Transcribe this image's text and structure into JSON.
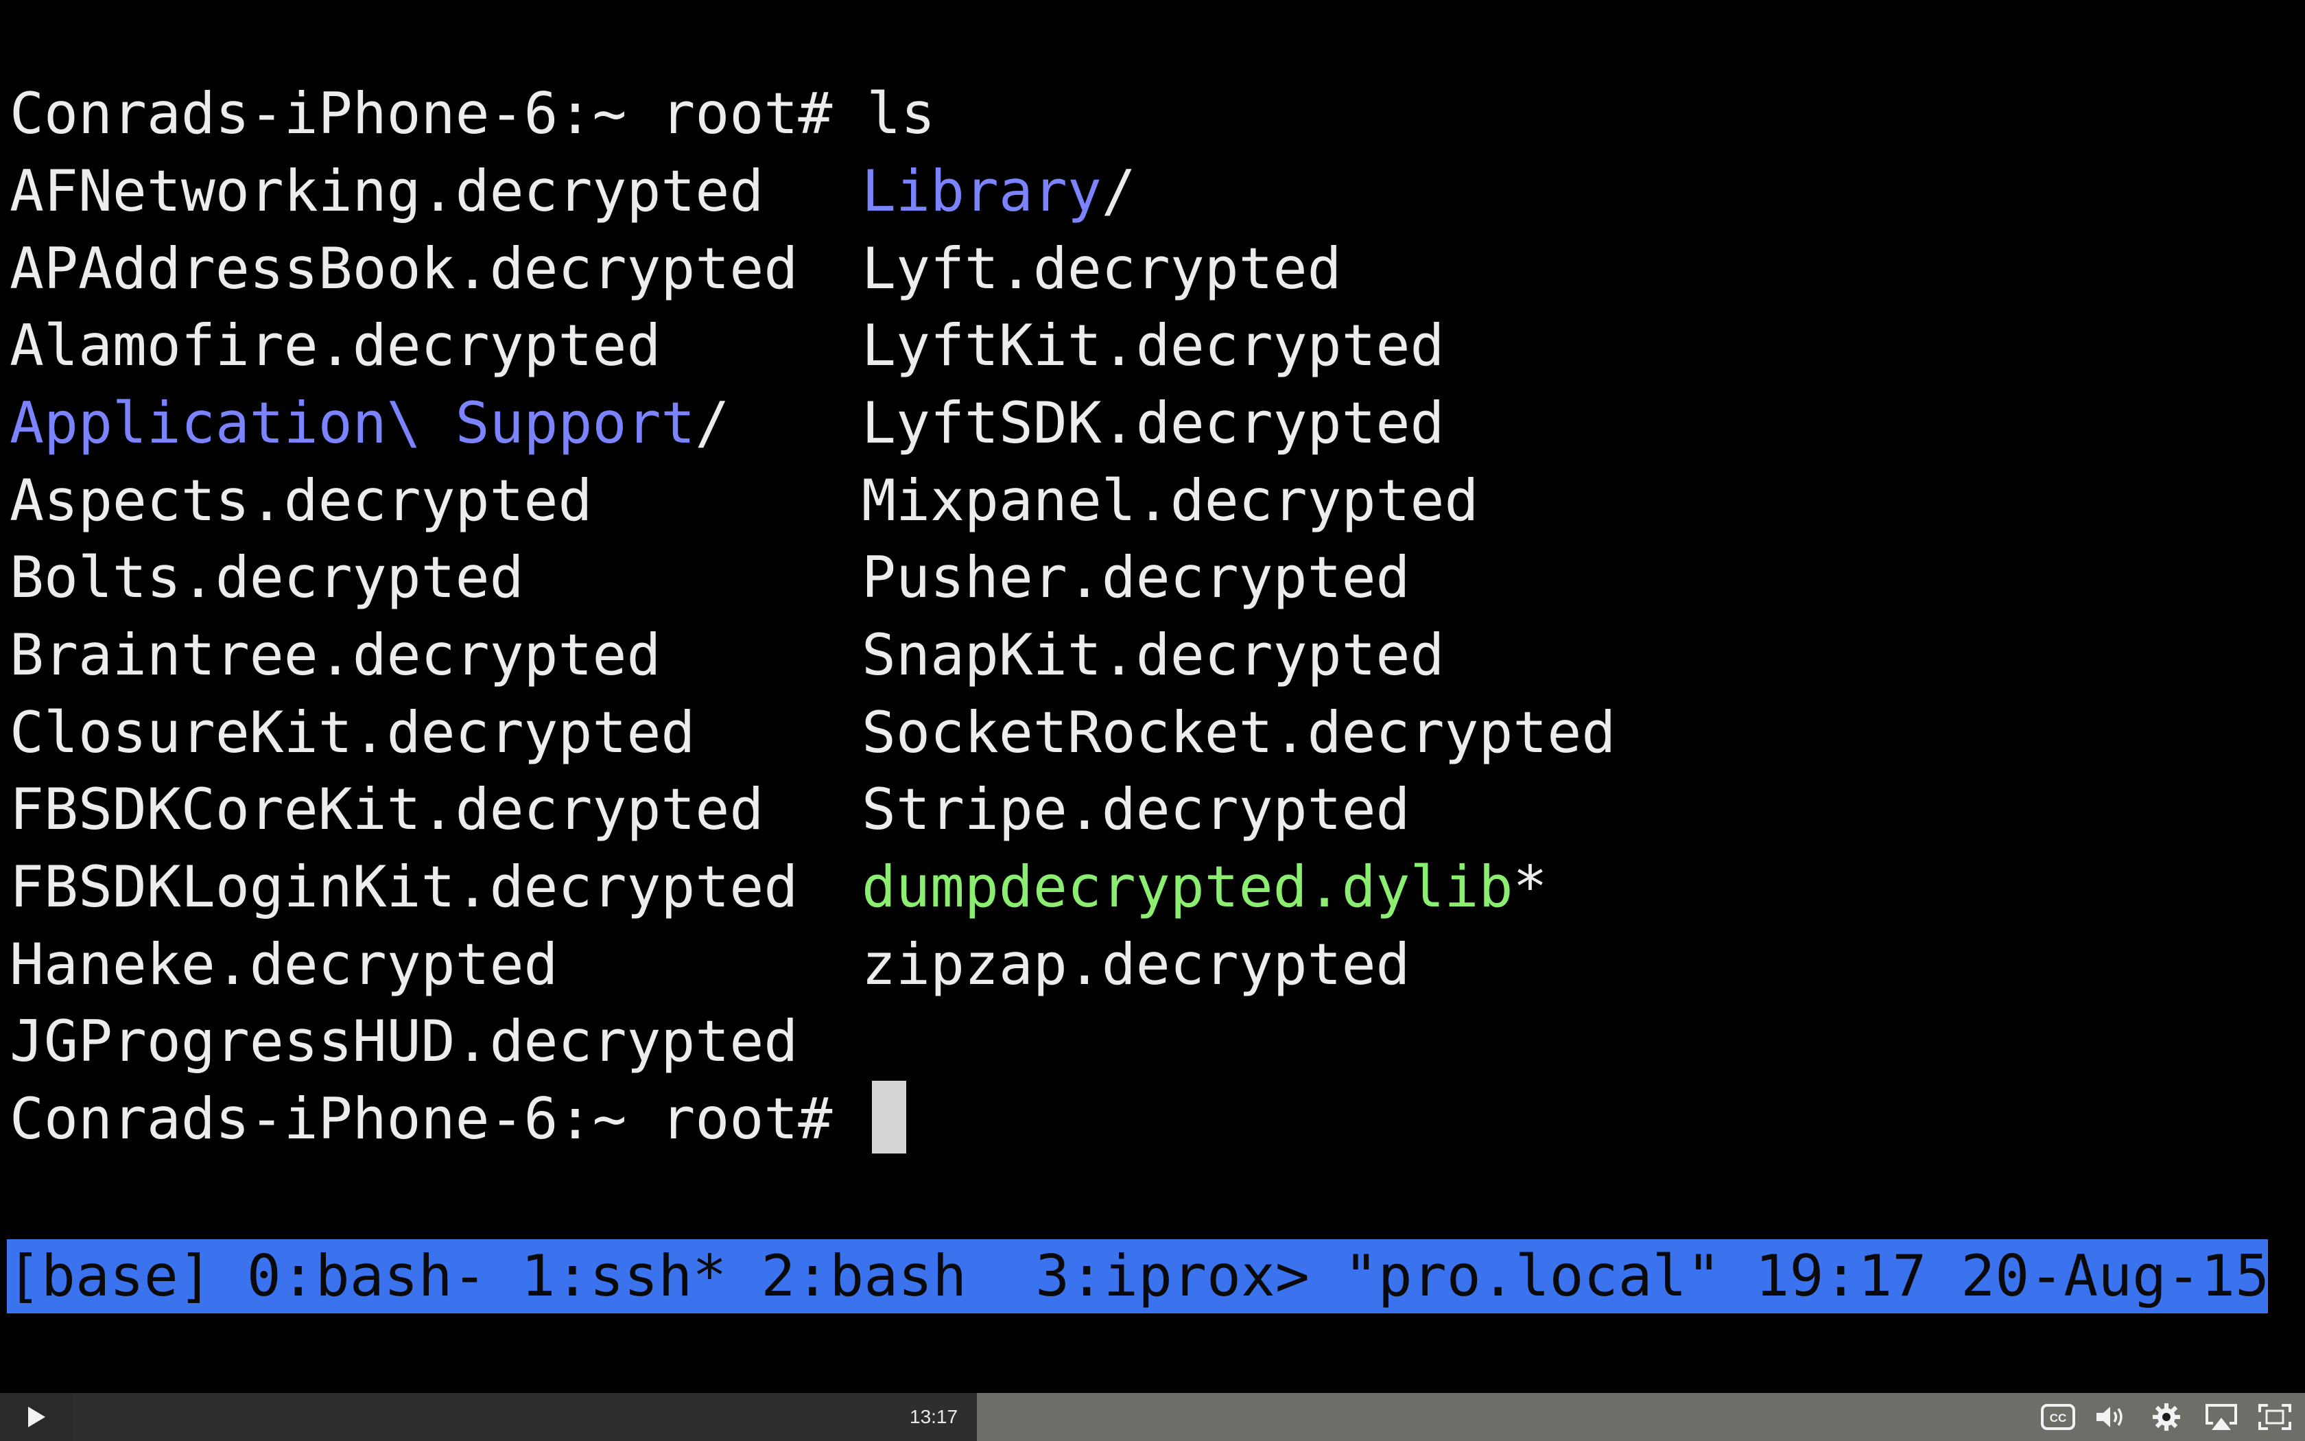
{
  "terminal": {
    "prompt_command": "Conrads-iPhone-6:~ root# ls",
    "prompt_final": "Conrads-iPhone-6:~ root# ",
    "left_column": [
      "AFNetworking.decrypted",
      "APAddressBook.decrypted",
      "Alamofire.decrypted",
      "Application\\ Support",
      "Aspects.decrypted",
      "Bolts.decrypted",
      "Braintree.decrypted",
      "ClosureKit.decrypted",
      "FBSDKCoreKit.decrypted",
      "FBSDKLoginKit.decrypted",
      "Haneke.decrypted",
      "JGProgressHUD.decrypted"
    ],
    "right_column": [
      "Library",
      "Lyft.decrypted",
      "LyftKit.decrypted",
      "LyftSDK.decrypted",
      "Mixpanel.decrypted",
      "Pusher.decrypted",
      "SnapKit.decrypted",
      "SocketRocket.decrypted",
      "Stripe.decrypted",
      "dumpdecrypted.dylib",
      "zipzap.decrypted"
    ],
    "dir_suffix": "/",
    "exec_suffix": "*"
  },
  "tmux_status": "[base] 0:bash- 1:ssh* 2:bash  3:iprox> \"pro.local\" 19:17 20-Aug-15",
  "player": {
    "timecode": "13:17",
    "progress_percent": 40.5,
    "icons": [
      "play-icon",
      "captions-icon",
      "volume-icon",
      "settings-icon",
      "airplay-icon",
      "fullscreen-icon"
    ]
  },
  "colors": {
    "background": "#000000",
    "text": "#ececec",
    "directory": "#7b83ff",
    "executable": "#8bee70",
    "status_bar": "#3b73ef"
  }
}
